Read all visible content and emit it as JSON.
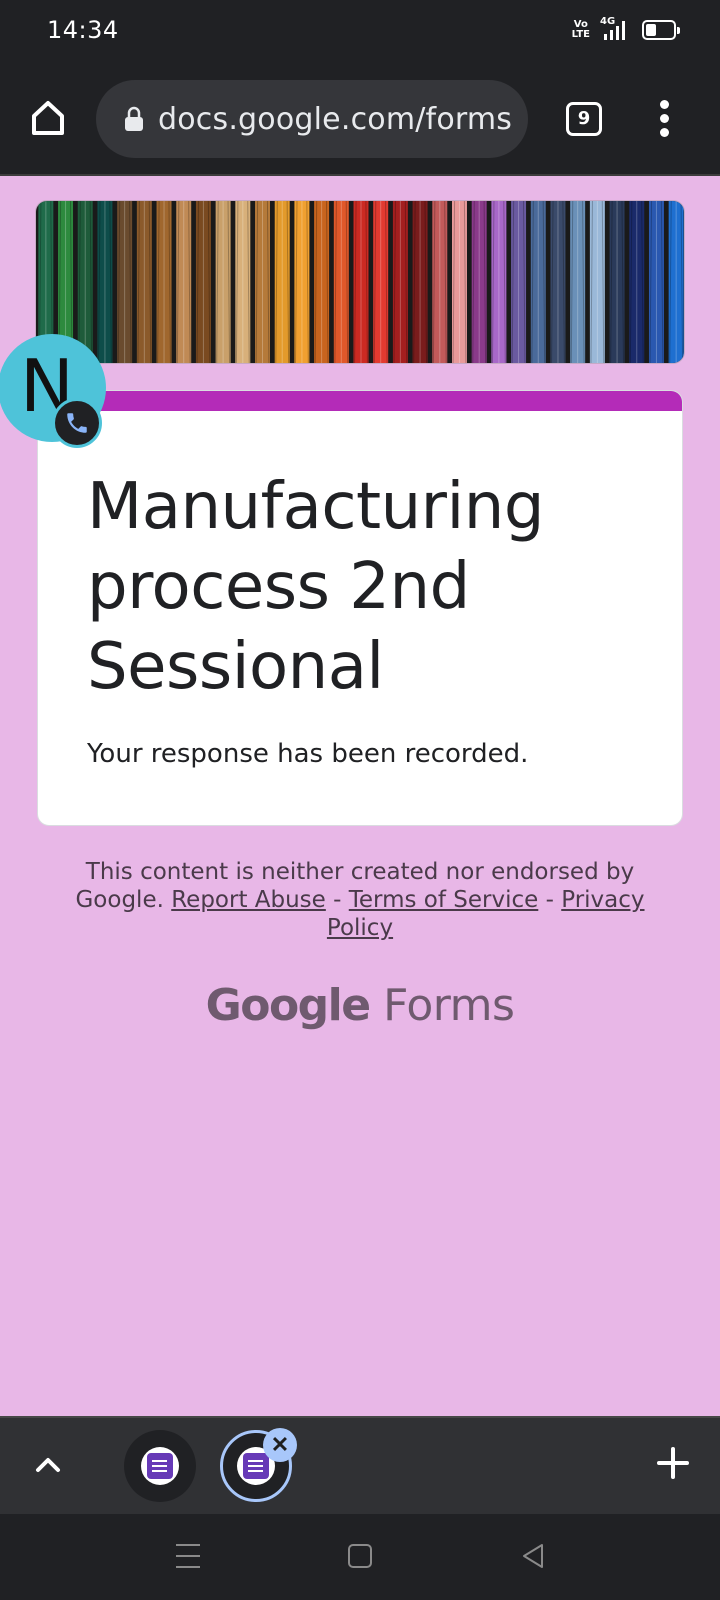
{
  "status_bar": {
    "time": "14:34",
    "volte_line1": "Vo",
    "volte_line2": "LTE",
    "network": "4G",
    "battery_level": 0.4
  },
  "browser": {
    "url": "docs.google.com/forms",
    "tab_count": "9"
  },
  "banner": {
    "colors": [
      "#1f6b4a",
      "#2d8a3e",
      "#1e5b3a",
      "#0e4d4a",
      "#6a4b2e",
      "#8b5a2b",
      "#a0672e",
      "#c08a55",
      "#7a4a20",
      "#c9a06a",
      "#d8b07a",
      "#b57a3a",
      "#e39a2b",
      "#f0a030",
      "#c8641e",
      "#e0582a",
      "#cc2a22",
      "#e23a30",
      "#a41f1f",
      "#7a1c1c",
      "#c25a5a",
      "#e89a9a",
      "#8a3a8a",
      "#a868c8",
      "#6a5aa0",
      "#4a6a9a",
      "#3a4a6a",
      "#6a90b8",
      "#9ab8d8",
      "#2a3a5a",
      "#1a2a6a",
      "#2a58b0",
      "#1e6fd0"
    ]
  },
  "chat_head": {
    "letter": "N"
  },
  "form": {
    "title": "Manufacturing process 2nd Sessional",
    "confirmation": "Your response has been recorded.",
    "accent_color": "#b42bb8"
  },
  "footer": {
    "disclaimer": "This content is neither created nor endorsed by Google.",
    "report_abuse": "Report Abuse",
    "separator": "-",
    "terms": "Terms of Service",
    "privacy": "Privacy Policy",
    "brand_google": "Google",
    "brand_forms": "Forms"
  },
  "tab_strip": {
    "close_label": "✕",
    "new_tab_label": "+"
  }
}
